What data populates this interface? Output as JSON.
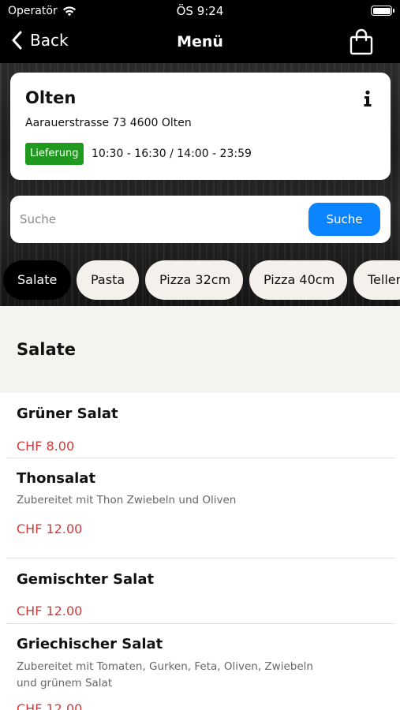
{
  "status": {
    "carrier": "Operatör",
    "time": "ÖS 9:24"
  },
  "nav": {
    "back_label": "Back",
    "title": "Menü"
  },
  "store": {
    "name": "Olten",
    "address": "Aarauerstrasse 73 4600 Olten",
    "badge": "Lieferung",
    "hours": "10:30 - 16:30 / 14:00 - 23:59",
    "badge_color": "#1f9a1f"
  },
  "search": {
    "placeholder": "Suche",
    "button_label": "Suche",
    "accent": "#0a84ff"
  },
  "categories": [
    "Salate",
    "Pasta",
    "Pizza 32cm",
    "Pizza 40cm",
    "Teller"
  ],
  "active_category": "Salate",
  "section": {
    "title": "Salate"
  },
  "items": [
    {
      "name": "Grüner Salat",
      "description": "",
      "price": "CHF 8.00"
    },
    {
      "name": "Thonsalat",
      "description": "Zubereitet mit Thon Zwiebeln und Oliven",
      "price": "CHF 12.00"
    },
    {
      "name": "Gemischter Salat",
      "description": "",
      "price": "CHF 12.00"
    },
    {
      "name": "Griechischer Salat",
      "description": "Zubereitet mit Tomaten, Gurken, Feta, Oliven, Zwiebeln und grünem Salat",
      "price": "CHF 12.00"
    }
  ],
  "price_color": "#d23b3b",
  "icons": {
    "back": "chevron-left-icon",
    "bag": "shopping-bag-icon",
    "info": "info-icon",
    "wifi": "wifi-icon",
    "battery": "battery-icon"
  }
}
